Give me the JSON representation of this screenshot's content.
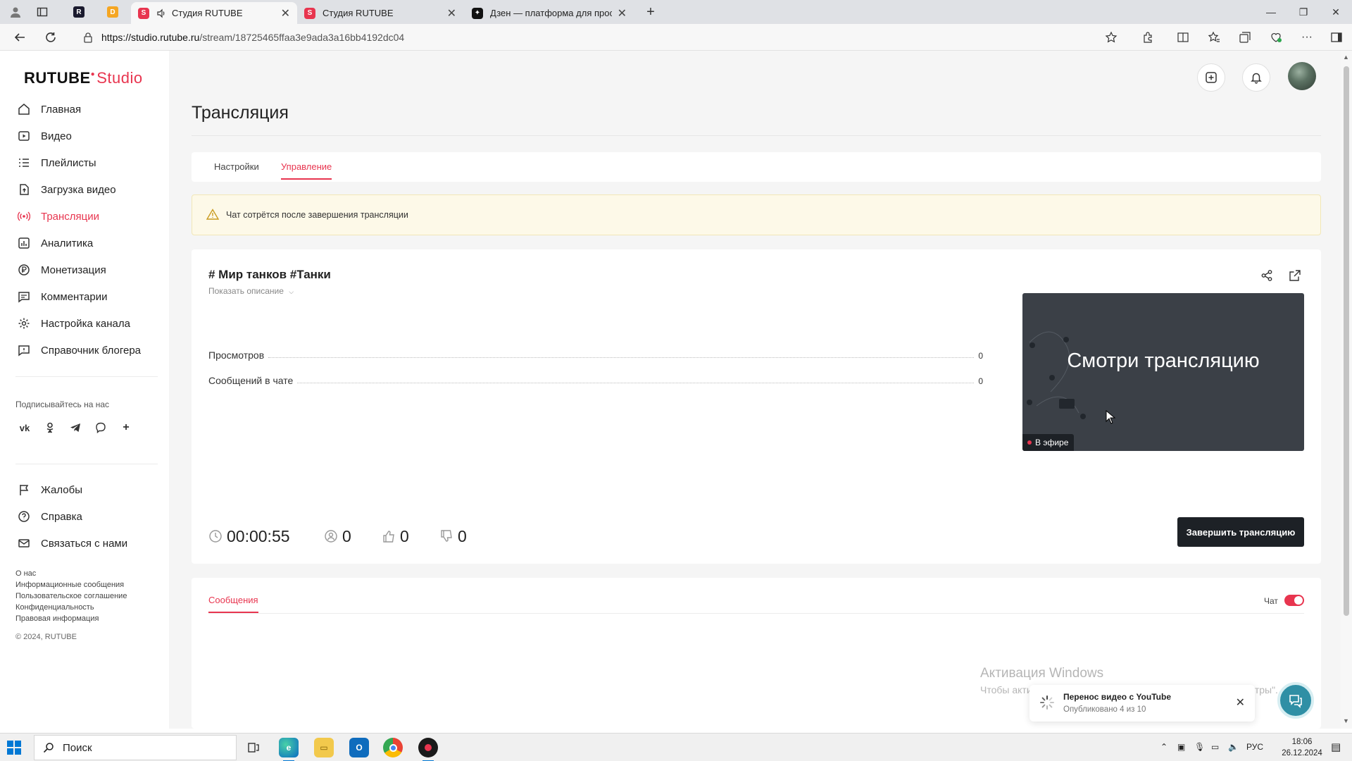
{
  "browser": {
    "tabs": [
      {
        "title": "Студия RUTUBE",
        "active": true,
        "audio": true
      },
      {
        "title": "Студия RUTUBE",
        "active": false
      },
      {
        "title": "Дзен — платформа для просмо",
        "active": false
      }
    ],
    "url_host": "https://studio.rutube.ru",
    "url_path": "/stream/18725465ffaa3e9ada3a16bb4192dc04"
  },
  "sidebar": {
    "logo_main": "RUTUBE",
    "logo_studio": "Studio",
    "items": [
      {
        "label": "Главная",
        "icon": "home-icon"
      },
      {
        "label": "Видео",
        "icon": "video-icon"
      },
      {
        "label": "Плейлисты",
        "icon": "playlist-icon"
      },
      {
        "label": "Загрузка видео",
        "icon": "upload-icon"
      },
      {
        "label": "Трансляции",
        "icon": "broadcast-icon",
        "active": true
      },
      {
        "label": "Аналитика",
        "icon": "analytics-icon"
      },
      {
        "label": "Монетизация",
        "icon": "monetization-icon"
      },
      {
        "label": "Комментарии",
        "icon": "comments-icon"
      },
      {
        "label": "Настройка канала",
        "icon": "settings-icon"
      },
      {
        "label": "Справочник блогера",
        "icon": "guide-icon"
      }
    ],
    "follow_label": "Подписывайтесь на нас",
    "socials": [
      "vk-icon",
      "ok-icon",
      "telegram-icon",
      "viber-icon",
      "plus-icon"
    ],
    "secondary_items": [
      {
        "label": "Жалобы",
        "icon": "flag-icon"
      },
      {
        "label": "Справка",
        "icon": "help-icon"
      },
      {
        "label": "Связаться с нами",
        "icon": "mail-icon"
      }
    ],
    "footer_links": [
      "О нас",
      "Информационные сообщения",
      "Пользовательское соглашение",
      "Конфиденциальность",
      "Правовая информация"
    ],
    "copyright": "© 2024, RUTUBE"
  },
  "main": {
    "page_title": "Трансляция",
    "tabs": [
      {
        "label": "Настройки",
        "active": false
      },
      {
        "label": "Управление",
        "active": true
      }
    ],
    "warning": "Чат сотрётся после завершения трансляции",
    "stream": {
      "title": "# Мир танков #Танки",
      "show_description": "Показать описание",
      "stats": [
        {
          "label": "Просмотров",
          "value": "0"
        },
        {
          "label": "Сообщений в чате",
          "value": "0"
        }
      ],
      "preview_text": "Смотри трансляцию",
      "live_badge": "В эфире",
      "duration": "00:00:55",
      "viewers": "0",
      "likes": "0",
      "dislikes": "0",
      "end_button": "Завершить трансляцию"
    },
    "messages_tab": "Сообщения",
    "chat_label": "Чат",
    "chat_enabled": true
  },
  "overlay": {
    "watermark_title": "Активация Windows",
    "watermark_text": "Чтобы активировать Windows, перейдите в раздел \"Параметры\".",
    "toast_title": "Перенос видео с YouTube",
    "toast_text": "Опубликовано 4 из 10"
  },
  "taskbar": {
    "search_placeholder": "Поиск",
    "lang": "РУС",
    "time": "18:06",
    "date": "26.12.2024"
  },
  "colors": {
    "accent": "#e8354f",
    "dark_button": "#1d2126",
    "warning_bg": "#fdf9e8"
  }
}
